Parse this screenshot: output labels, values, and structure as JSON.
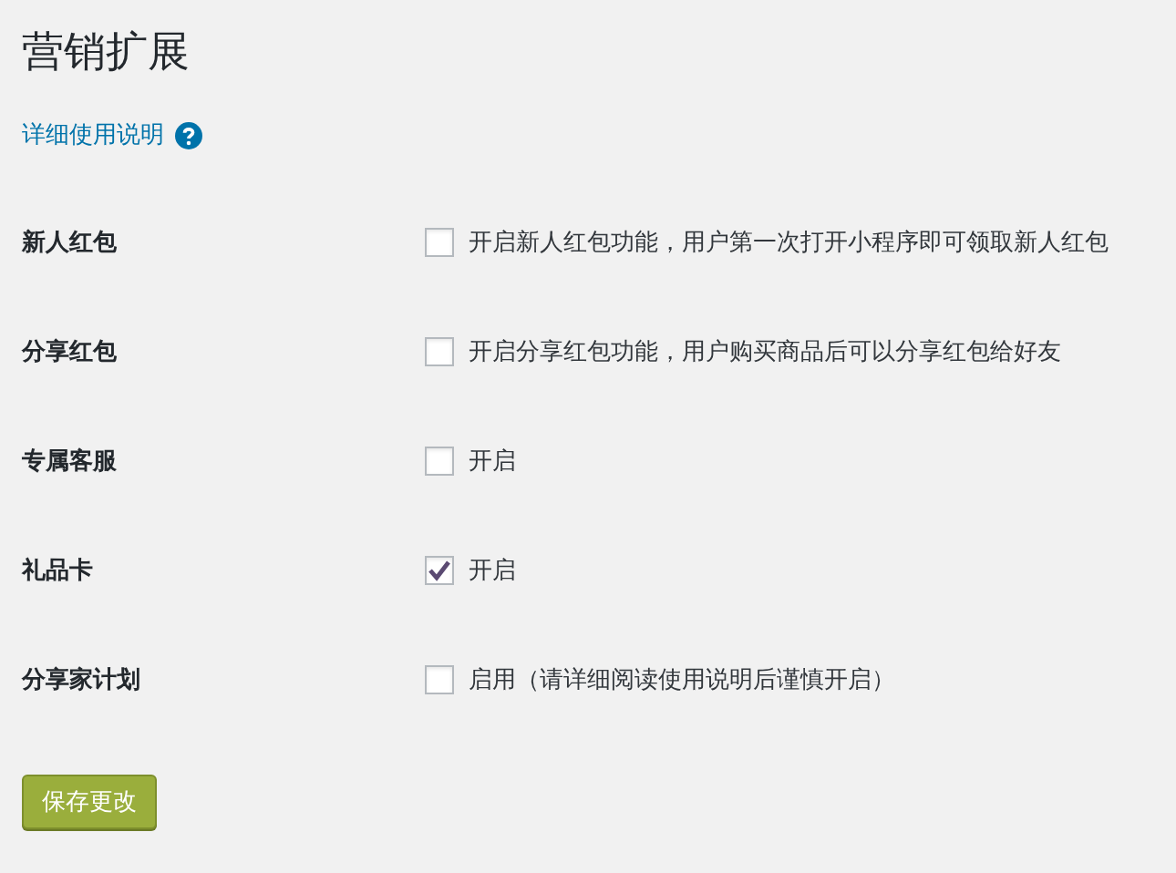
{
  "title": "营销扩展",
  "help_link": "详细使用说明",
  "settings": [
    {
      "label": "新人红包",
      "checked": false,
      "description": "开启新人红包功能，用户第一次打开小程序即可领取新人红包"
    },
    {
      "label": "分享红包",
      "checked": false,
      "description": "开启分享红包功能，用户购买商品后可以分享红包给好友"
    },
    {
      "label": "专属客服",
      "checked": false,
      "description": "开启"
    },
    {
      "label": "礼品卡",
      "checked": true,
      "description": "开启"
    },
    {
      "label": "分享家计划",
      "checked": false,
      "description": "启用（请详细阅读使用说明后谨慎开启）"
    }
  ],
  "save_button": "保存更改"
}
